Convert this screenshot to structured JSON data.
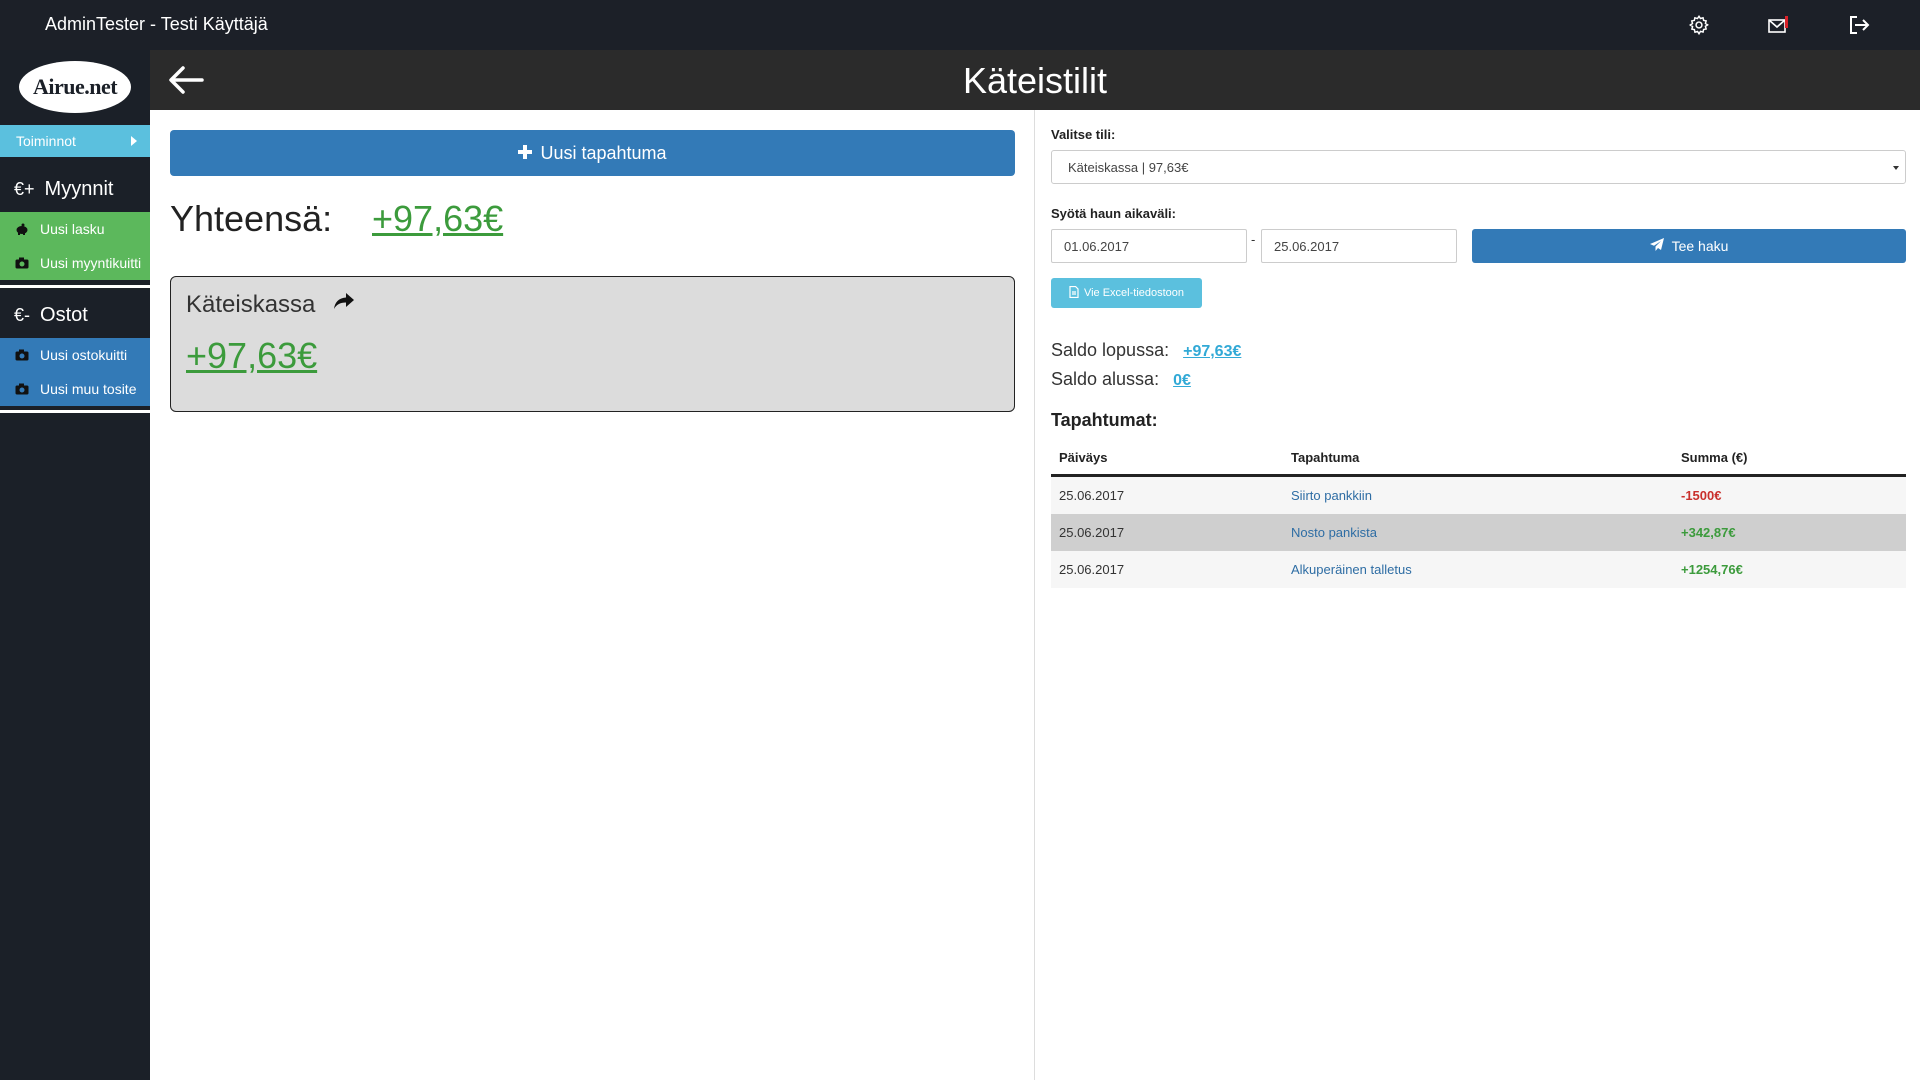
{
  "topbar": {
    "title": "AdminTester - Testi Käyttäjä",
    "icons": [
      "gear-icon",
      "mail-icon",
      "logout-icon"
    ]
  },
  "sidebar": {
    "logo": "Airue.net",
    "toiminnot": "Toiminnot",
    "sales": {
      "currency": "€+",
      "title": "Myynnit",
      "items": [
        {
          "label": "Uusi lasku",
          "icon": "piggy-bank-icon"
        },
        {
          "label": "Uusi myyntikuitti",
          "icon": "camera-icon"
        }
      ]
    },
    "purchases": {
      "currency": "€-",
      "title": "Ostot",
      "items": [
        {
          "label": "Uusi ostokuitti",
          "icon": "camera-icon"
        },
        {
          "label": "Uusi muu tosite",
          "icon": "camera-icon"
        }
      ]
    }
  },
  "header": {
    "title": "Käteistilit"
  },
  "left": {
    "new_event_label": "Uusi tapahtuma",
    "total_label": "Yhteensä:",
    "total_value": "+97,63€",
    "account": {
      "name": "Käteiskassa",
      "value": "+97,63€"
    }
  },
  "right": {
    "select_account_label": "Valitse tili:",
    "selected_account": "Käteiskassa | 97,63€",
    "date_range_label": "Syötä haun aikaväli:",
    "date_from": "01.06.2017",
    "date_separator": "-",
    "date_to": "25.06.2017",
    "search_label": "Tee haku",
    "excel_label": "Vie Excel-tiedostoon",
    "saldo_end_label": "Saldo lopussa:",
    "saldo_end_value": "+97,63€",
    "saldo_start_label": "Saldo alussa:",
    "saldo_start_value": "0€",
    "events_title": "Tapahtumat:",
    "table": {
      "headers": [
        "Päiväys",
        "Tapahtuma",
        "Summa (€)"
      ],
      "rows": [
        {
          "date": "25.06.2017",
          "event": "Siirto pankkiin",
          "amount": "-1500€"
        },
        {
          "date": "25.06.2017",
          "event": "Nosto pankista",
          "amount": "+342,87€"
        },
        {
          "date": "25.06.2017",
          "event": "Alkuperäinen talletus",
          "amount": "+1254,76€"
        }
      ]
    }
  },
  "colors": {
    "topbar_bg": "#1c2028",
    "header_bg": "#2b2b2b",
    "primary": "#337ab7",
    "info": "#5bc0de",
    "success": "#5cb85c",
    "positive_text": "#3c9b3c",
    "negative_text": "#c9302c"
  }
}
